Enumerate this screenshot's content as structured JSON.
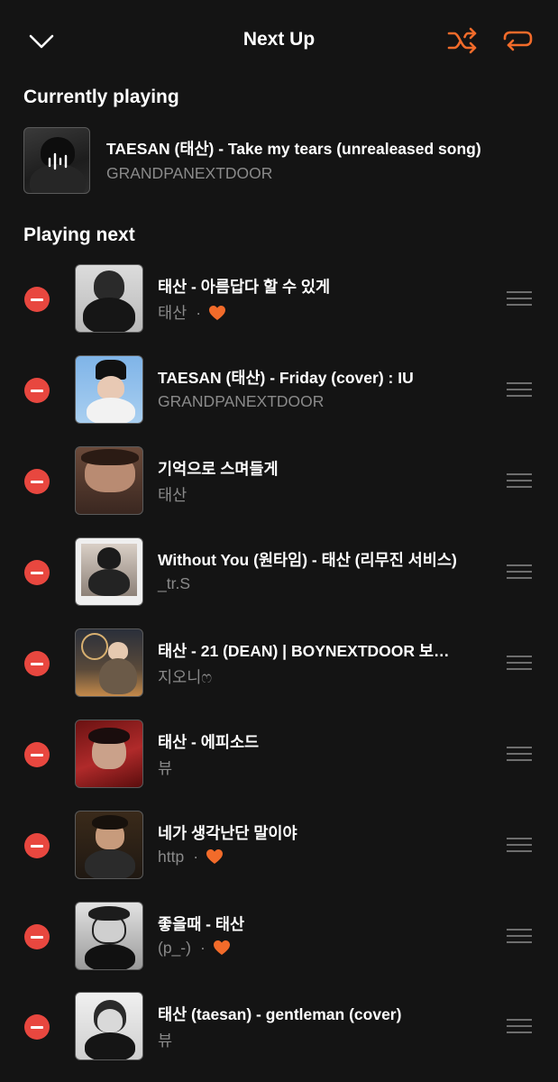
{
  "header": {
    "title": "Next Up",
    "collapse_icon": "chevron-down-icon",
    "shuffle_icon": "shuffle-icon",
    "repeat_icon": "repeat-icon",
    "accent_color": "#f26b2a"
  },
  "currently_playing": {
    "heading": "Currently playing",
    "title": "TAESAN (태산)  -  Take my tears (unrealeased song)",
    "artist": "GRANDPANEXTDOOR",
    "icon": "equalizer-icon"
  },
  "playing_next": {
    "heading": "Playing next",
    "items": [
      {
        "title": "태산  -  아름답다 할 수 있게",
        "artist": "태산",
        "liked": true
      },
      {
        "title": "TAESAN (태산)  -  Friday (cover) : IU",
        "artist": "GRANDPANEXTDOOR",
        "liked": false
      },
      {
        "title": "기억으로 스며들게",
        "artist": "태산",
        "liked": false
      },
      {
        "title": "Without You (원타임) - 태산 (리무진 서비스)",
        "artist": "_tr.S",
        "liked": false
      },
      {
        "title": "태산  -  21 (DEAN) | BOYNEXTDOOR 보…",
        "artist": "지오니ෆ",
        "liked": false
      },
      {
        "title": "태산  -  에피소드",
        "artist": "뷰",
        "liked": false
      },
      {
        "title": "네가 생각난단 말이야",
        "artist": "http",
        "liked": true
      },
      {
        "title": "좋을때  -  태산",
        "artist": "(p_-)",
        "liked": true
      },
      {
        "title": "태산 (taesan)  -  gentleman (cover)",
        "artist": "뷰",
        "liked": false
      }
    ]
  },
  "colors": {
    "background": "#141414",
    "remove": "#e8473f",
    "heart": "#f26b2a",
    "secondary_text": "#8a8a8a"
  },
  "item_separator": "·"
}
